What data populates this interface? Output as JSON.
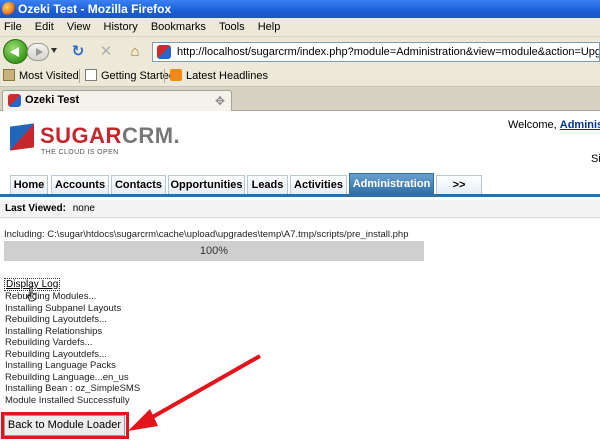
{
  "window": {
    "title": "Ozeki Test - Mozilla Firefox"
  },
  "menu": [
    "File",
    "Edit",
    "View",
    "History",
    "Bookmarks",
    "Tools",
    "Help"
  ],
  "url": "http://localhost/sugarcrm/index.php?module=Administration&view=module&action=UpgradeWizard_comm",
  "bookmarks": [
    "Most Visited",
    "Getting Started",
    "Latest Headlines"
  ],
  "tab": {
    "title": "Ozeki Test"
  },
  "header": {
    "logo_text_sugar": "SUGAR",
    "logo_text_crm": "CRM.",
    "logo_tagline": "THE CLOUD IS OPEN",
    "welcome_prefix": "Welcome, ",
    "welcome_user": "Administ",
    "stray": "Si"
  },
  "module_tabs": [
    "Home",
    "Accounts",
    "Contacts",
    "Opportunities",
    "Leads",
    "Activities",
    "Administration",
    ">>"
  ],
  "active_tab": "Administration",
  "last_viewed": {
    "label": "Last Viewed:",
    "value": "none"
  },
  "install": {
    "including": "Including: C:\\sugar\\htdocs\\sugarcrm\\cache\\upload\\upgrades\\temp\\A7.tmp/scripts/pre_install.php",
    "progress_percent": 100,
    "progress_label": "100%",
    "display_log": "Display Log",
    "log": [
      "Rebuilding Modules...",
      "Installing Subpanel Layouts",
      "Rebuilding Layoutdefs...",
      "Installing Relationships",
      "Rebuilding Vardefs...",
      "Rebuilding Layoutdefs...",
      "Installing Language Packs",
      "Rebuilding Language...en_us",
      "Installing Bean : oz_SimpleSMS",
      "Module Installed Successfully"
    ],
    "back_button": "Back to Module Loader"
  },
  "colors": {
    "highlight": "#e3141b",
    "tab_active": "#2e6ea6",
    "brand_red": "#c5272c"
  }
}
